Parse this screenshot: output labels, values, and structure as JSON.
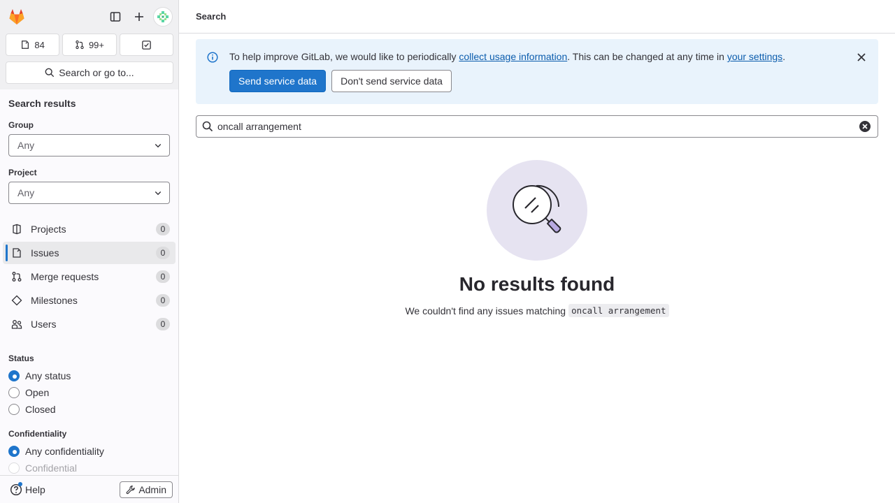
{
  "sidebar": {
    "counters": {
      "issues": "84",
      "merge_requests": "99+",
      "todos": ""
    },
    "search_go": "Search or go to...",
    "title": "Search results",
    "group_label": "Group",
    "group_value": "Any",
    "project_label": "Project",
    "project_value": "Any",
    "nav": [
      {
        "label": "Projects",
        "count": "0",
        "icon": "project-icon"
      },
      {
        "label": "Issues",
        "count": "0",
        "icon": "issues-icon",
        "active": true
      },
      {
        "label": "Merge requests",
        "count": "0",
        "icon": "merge-request-icon"
      },
      {
        "label": "Milestones",
        "count": "0",
        "icon": "milestone-icon"
      },
      {
        "label": "Users",
        "count": "0",
        "icon": "users-icon"
      }
    ],
    "status_label": "Status",
    "status_options": [
      "Any status",
      "Open",
      "Closed"
    ],
    "confidentiality_label": "Confidentiality",
    "confidentiality_options": [
      "Any confidentiality",
      "Confidential"
    ],
    "help": "Help",
    "admin": "Admin"
  },
  "topbar": {
    "breadcrumb": "Search"
  },
  "alert": {
    "text_before": "To help improve GitLab, we would like to periodically ",
    "link1": "collect usage information",
    "text_middle": ". This can be changed at any time in ",
    "link2": "your settings",
    "text_after": ".",
    "primary_button": "Send service data",
    "secondary_button": "Don't send service data"
  },
  "search": {
    "value": "oncall arrangement"
  },
  "empty_state": {
    "title": "No results found",
    "description": "We couldn't find any issues matching",
    "query": "oncall arrangement"
  },
  "colors": {
    "accent": "#1f75cb",
    "alert_bg": "#e9f3fc",
    "illustration_bg": "#e6e3f1"
  }
}
